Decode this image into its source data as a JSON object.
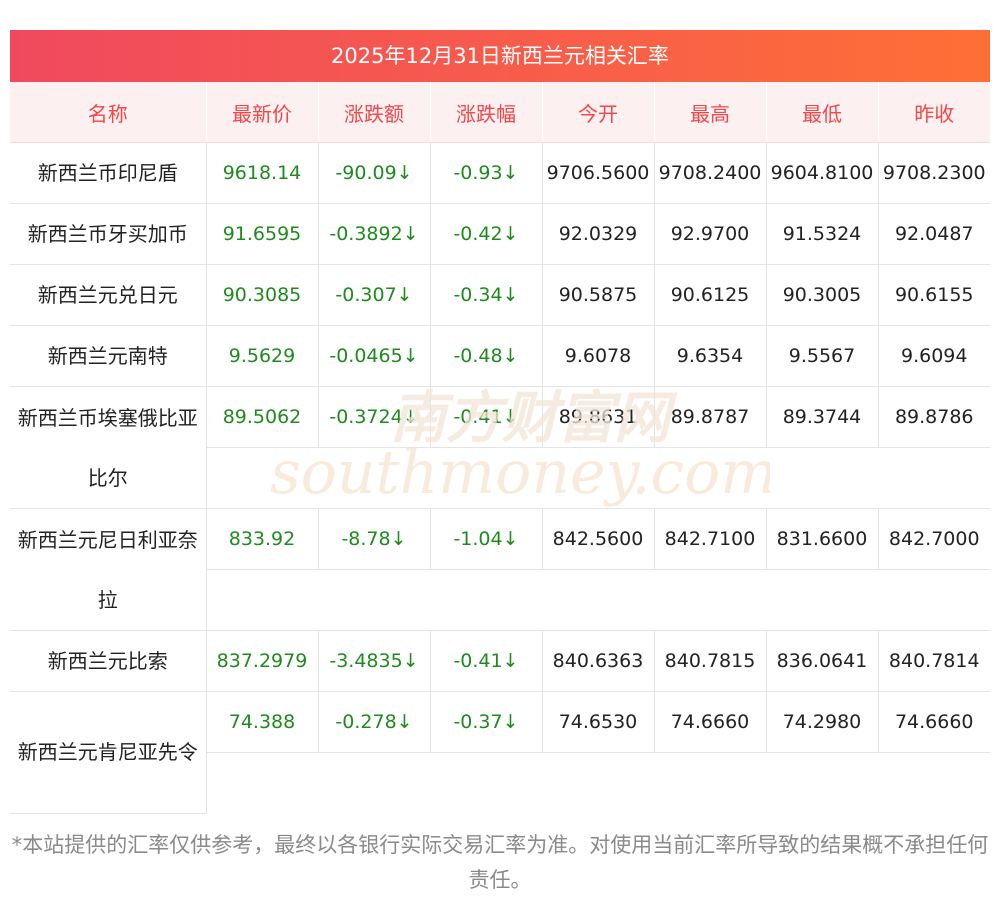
{
  "title": "2025年12月31日新西兰元相关汇率",
  "headers": [
    "名称",
    "最新价",
    "涨跌额",
    "涨跌幅",
    "今开",
    "最高",
    "最低",
    "昨收"
  ],
  "rows": [
    {
      "name": "新西兰币印尼盾",
      "latest": "9618.14",
      "change": "-90.09↓",
      "pct": "-0.93↓",
      "open": "9706.5600",
      "high": "9708.2400",
      "low": "9604.8100",
      "prev": "9708.2300"
    },
    {
      "name": "新西兰币牙买加币",
      "latest": "91.6595",
      "change": "-0.3892↓",
      "pct": "-0.42↓",
      "open": "92.0329",
      "high": "92.9700",
      "low": "91.5324",
      "prev": "92.0487"
    },
    {
      "name": "新西兰元兑日元",
      "latest": "90.3085",
      "change": "-0.307↓",
      "pct": "-0.34↓",
      "open": "90.5875",
      "high": "90.6125",
      "low": "90.3005",
      "prev": "90.6155"
    },
    {
      "name": "新西兰元南特",
      "latest": "9.5629",
      "change": "-0.0465↓",
      "pct": "-0.48↓",
      "open": "9.6078",
      "high": "9.6354",
      "low": "9.5567",
      "prev": "9.6094"
    },
    {
      "name": "新西兰币埃塞俄比亚比尔",
      "latest": "89.5062",
      "change": "-0.3724↓",
      "pct": "-0.41↓",
      "open": "89.8631",
      "high": "89.8787",
      "low": "89.3744",
      "prev": "89.8786"
    },
    {
      "name": "新西兰元尼日利亚奈拉",
      "latest": "833.92",
      "change": "-8.78↓",
      "pct": "-1.04↓",
      "open": "842.5600",
      "high": "842.7100",
      "low": "831.6600",
      "prev": "842.7000"
    },
    {
      "name": "新西兰元比索",
      "latest": "837.2979",
      "change": "-3.4835↓",
      "pct": "-0.41↓",
      "open": "840.6363",
      "high": "840.7815",
      "low": "836.0641",
      "prev": "840.7814"
    },
    {
      "name": "新西兰元肯尼亚先令",
      "latest": "74.388",
      "change": "-0.278↓",
      "pct": "-0.37↓",
      "open": "74.6530",
      "high": "74.6660",
      "low": "74.2980",
      "prev": "74.6660"
    }
  ],
  "watermark": {
    "cn": "南方财富网",
    "en": "southmoney.com"
  },
  "footer": "*本站提供的汇率仅供参考，最终以各银行实际交易汇率为准。对使用当前汇率所导致的结果概不承担任何责任。"
}
